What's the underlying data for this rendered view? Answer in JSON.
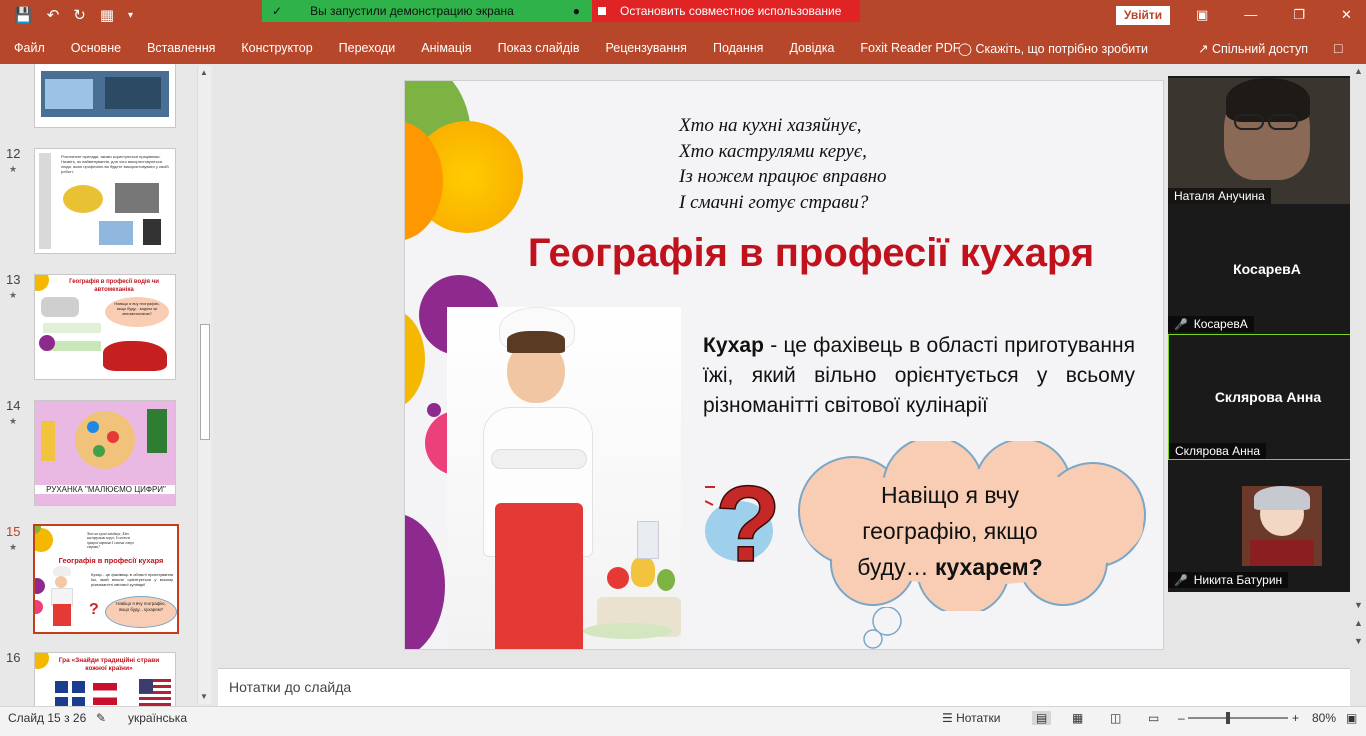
{
  "share": {
    "on_label": "Вы запустили демонстрацию экрана",
    "stop_label": "Остановить совместное использование"
  },
  "titlebar": {
    "signin": "Увійти"
  },
  "ribbon": {
    "tabs": [
      "Файл",
      "Основне",
      "Вставлення",
      "Конструктор",
      "Переходи",
      "Анімація",
      "Показ слайдів",
      "Рецензування",
      "Подання",
      "Довідка",
      "Foxit Reader PDF"
    ],
    "tellme": "Скажіть, що потрібно зробити",
    "share": "Спільний доступ"
  },
  "thumbs": {
    "n12": "12",
    "n13": "13",
    "n14": "14",
    "n15": "15",
    "n16": "16",
    "t12_text": "Розгляньте прилади, якими користуються працівники. Назвіть, як найменування, для чого використовуються люди, якою професією ви будете використовувати у своїй роботі.",
    "t13_title": "Географія в професії водія чи автомеханіка",
    "t13_cloud": "Навіщо я вчу географію, якщо буду... водієм чи автомеханіком?",
    "t14_title": "РУХАНКА \"МАЛЮЄМО ЦИФРИ\"",
    "t15_poem": "Хто на кухні хазяйнує, Хто каструлями керує, Із ножем працює вправно І смачні готує страви?",
    "t15_title": "Географія в професії кухаря",
    "t15_def": "Кухар - це фахівець в області приготування їжі, який вільно орієнтується у всьому різноманітті світової кулінарії",
    "t15_cloud": "Навіщо я вчу географію, якщо буду... кухарем?",
    "t16_title": "Гра «Знайди традиційні страви кожної країни»"
  },
  "slide": {
    "poem": [
      "Хто на кухні хазяйнує,",
      "Хто каструлями керує,",
      "Із ножем працює вправно",
      "І смачні готує страви?"
    ],
    "title": "Географія в професії кухаря",
    "def_term": "Кухар",
    "def_rest": " - це фахівець в області приготування їжі, який вільно орієнтується у всьому різноманітті світової кулінарії",
    "cloud_line1": "Навіщо я вчу",
    "cloud_line2": "географію, якщо",
    "cloud_line3a": "буду… ",
    "cloud_line3b": "кухарем?"
  },
  "video": {
    "p1": "Наталя Анучина",
    "p2_center": "КосаревА",
    "p2_name": "КосаревА",
    "p3_center": "Склярова Анна",
    "p3_name": "Склярова Анна",
    "p4_name": "Никита Батурин"
  },
  "notes": {
    "placeholder": "Нотатки до слайда"
  },
  "status": {
    "slide": "Слайд 15 з 26",
    "lang": "українська",
    "notes": "Нотатки",
    "zoom": "80%"
  },
  "colors": {
    "accent": "#b7472a",
    "title_red": "#c0121c",
    "share_green": "#2fb24a",
    "stop_red": "#e02426",
    "cloud_fill": "#f8cdb4",
    "cloud_stroke": "#7aa7c7"
  }
}
